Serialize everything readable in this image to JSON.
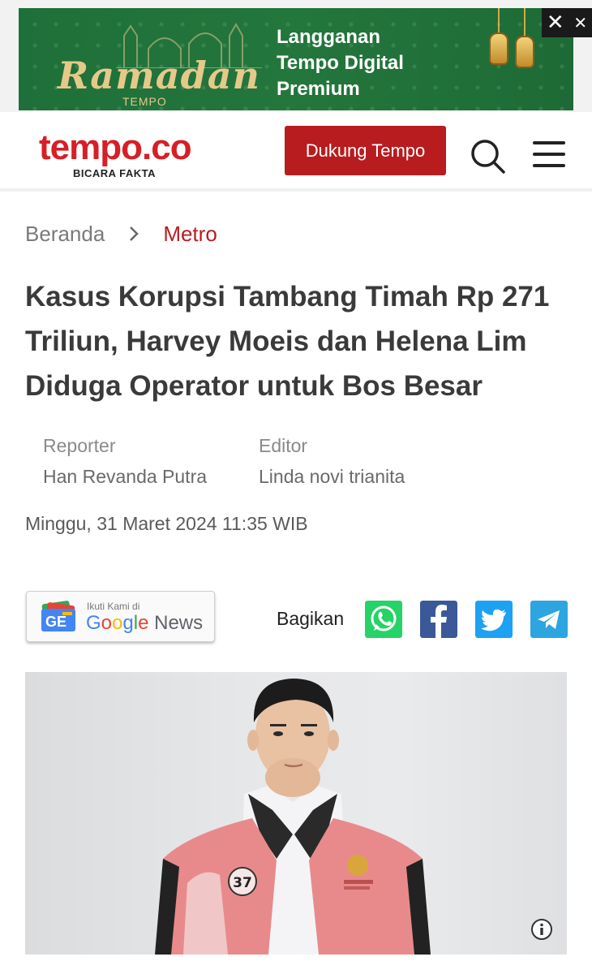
{
  "ad": {
    "brand_script": "Ramadan",
    "brand_sub": "TEMPO",
    "headline_lines": [
      "Langganan",
      "Tempo Digital",
      "Premium"
    ],
    "close_icons": [
      "close-icon",
      "close-icon"
    ],
    "colors": {
      "background": "#1f6f3a",
      "gold": "#e6c98a"
    }
  },
  "header": {
    "logo_text": "tempo.co",
    "tagline": "BICARA FAKTA",
    "support_button": "Dukung Tempo",
    "search_icon": "search-icon",
    "menu_icon": "hamburger-menu-icon",
    "colors": {
      "brand_red": "#d61f26",
      "button_red": "#b81c1f"
    }
  },
  "breadcrumb": {
    "home": "Beranda",
    "separator_icon": "chevron-right-icon",
    "category": "Metro"
  },
  "article": {
    "title_lines": [
      "Kasus Korupsi Tambang Timah Rp 271",
      "Triliun, Harvey Moeis dan Helena Lim",
      "Diduga Operator untuk Bos Besar"
    ],
    "reporter_label": "Reporter",
    "reporter_name": "Han Revanda Putra",
    "editor_label": "Editor",
    "editor_name": "Linda novi trianita",
    "date": "Minggu, 31 Maret 2024 11:35 WIB"
  },
  "follow": {
    "small_text": "Ikuti Kami di",
    "google": [
      "G",
      "o",
      "o",
      "g",
      "l",
      "e"
    ],
    "news": "News",
    "icon": "google-news-icon"
  },
  "share": {
    "label": "Bagikan",
    "buttons": [
      {
        "name": "whatsapp",
        "icon": "whatsapp-icon",
        "color": "#25d366"
      },
      {
        "name": "facebook",
        "icon": "facebook-icon",
        "color": "#3b5998"
      },
      {
        "name": "twitter",
        "icon": "twitter-icon",
        "color": "#1da1f2"
      },
      {
        "name": "telegram",
        "icon": "telegram-icon",
        "color": "#2ca5e0"
      }
    ]
  },
  "photo": {
    "vest_number": "37",
    "info_icon": "info-icon"
  }
}
